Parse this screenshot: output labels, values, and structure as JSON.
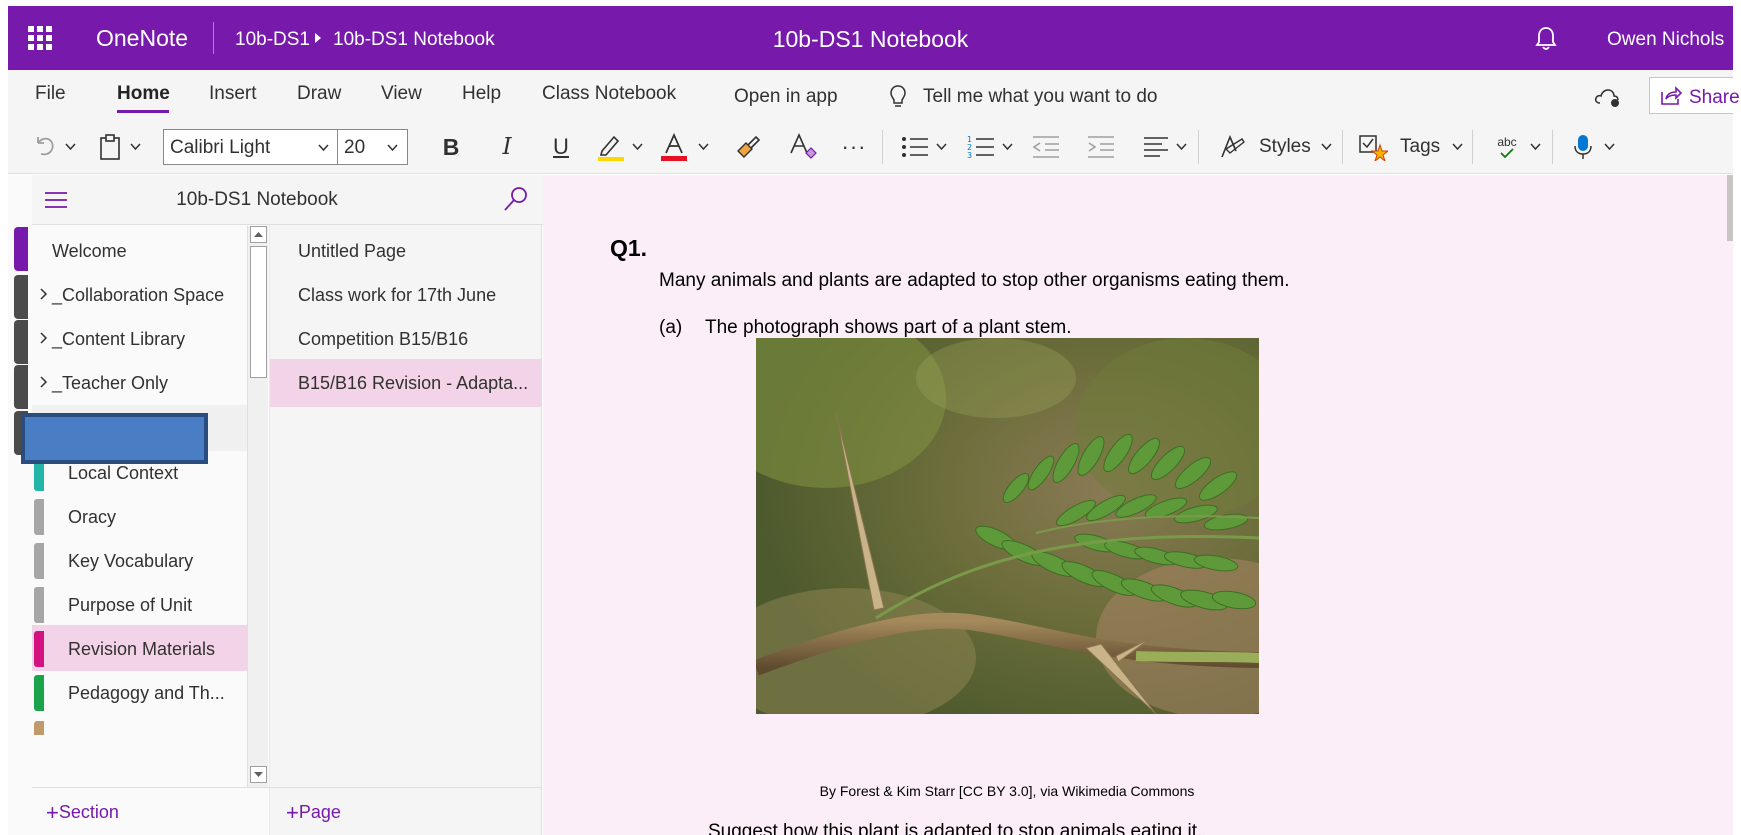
{
  "titlebar": {
    "app_name": "OneNote",
    "breadcrumb": [
      "10b-DS1",
      "10b-DS1 Notebook"
    ],
    "document_title": "10b-DS1 Notebook",
    "user_name": "Owen Nichols",
    "bg_color": "#7719aa"
  },
  "menu": {
    "items": [
      "File",
      "Home",
      "Insert",
      "Draw",
      "View",
      "Help",
      "Class Notebook"
    ],
    "active": "Home",
    "open_in_app": "Open in app",
    "tell_me": "Tell me what you want to do",
    "share": "Share"
  },
  "toolbar": {
    "font_name": "Calibri Light",
    "font_size": "20",
    "styles_label": "Styles",
    "tags_label": "Tags",
    "spelling_label": "abc",
    "highlight_color": "#ffd700",
    "font_color": "#e81123"
  },
  "sections_pane": {
    "notebook_title": "10b-DS1 Notebook",
    "items": [
      {
        "label": "Welcome",
        "type": "section"
      },
      {
        "label": "_Collaboration Space",
        "type": "group"
      },
      {
        "label": "_Content Library",
        "type": "group"
      },
      {
        "label": "_Teacher Only",
        "type": "group"
      },
      {
        "label": "Local Context",
        "type": "section",
        "color": "#22b5a8"
      },
      {
        "label": "Oracy",
        "type": "section",
        "color": "#a6a6a6"
      },
      {
        "label": "Key Vocabulary",
        "type": "section",
        "color": "#a6a6a6"
      },
      {
        "label": "Purpose of Unit",
        "type": "section",
        "color": "#a6a6a6"
      },
      {
        "label": "Revision Materials",
        "type": "section",
        "color": "#d4127f",
        "selected": true
      },
      {
        "label": "Pedagogy and Th...",
        "type": "section",
        "color": "#1aa34a"
      }
    ],
    "add_section": "Section"
  },
  "pages_pane": {
    "items": [
      {
        "label": "Untitled Page"
      },
      {
        "label": "Class work for 17th June"
      },
      {
        "label": "Competition B15/B16"
      },
      {
        "label": "B15/B16 Revision - Adapta...",
        "selected": true
      }
    ],
    "add_page": "Page"
  },
  "canvas": {
    "question_number": "Q1.",
    "intro": "Many animals and plants are adapted to stop other organisms eating them.",
    "part_label": "(a)",
    "part_text": "The photograph shows part of a plant stem.",
    "photo_credit": "By Forest & Kim Starr [CC BY 3.0], via Wikimedia Commons",
    "prompt": "Suggest how this plant is adapted to stop animals eating it."
  }
}
